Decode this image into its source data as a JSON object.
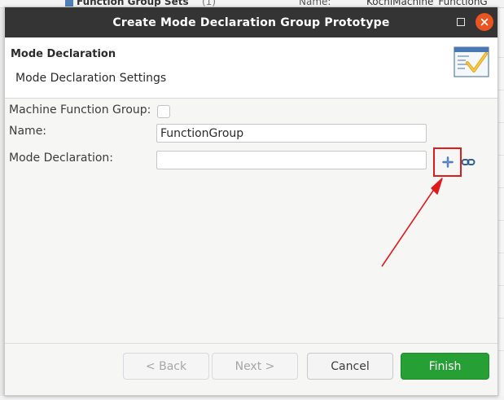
{
  "background": {
    "left_fragment": "Function Group Sets",
    "left_count": "(1)",
    "right_label": "Name:",
    "right_value": "KochiMachine_FunctionG"
  },
  "dialog": {
    "title": "Create Mode Declaration Group Prototype",
    "header_title": "Mode Declaration",
    "header_description": "Mode Declaration Settings",
    "icon": "wizard-checklist-icon"
  },
  "form": {
    "machine_function_group_label": "Machine Function Group:",
    "machine_function_group_checked": false,
    "name_label": "Name:",
    "name_value": "FunctionGroup",
    "mode_declaration_label": "Mode Declaration:",
    "mode_declaration_value": ""
  },
  "buttons": {
    "back": "< Back",
    "next": "Next >",
    "cancel": "Cancel",
    "finish": "Finish"
  },
  "colors": {
    "title_bar": "#343434",
    "close_button": "#e95420",
    "finish_button": "#26a035",
    "highlight": "#e11b1b"
  }
}
